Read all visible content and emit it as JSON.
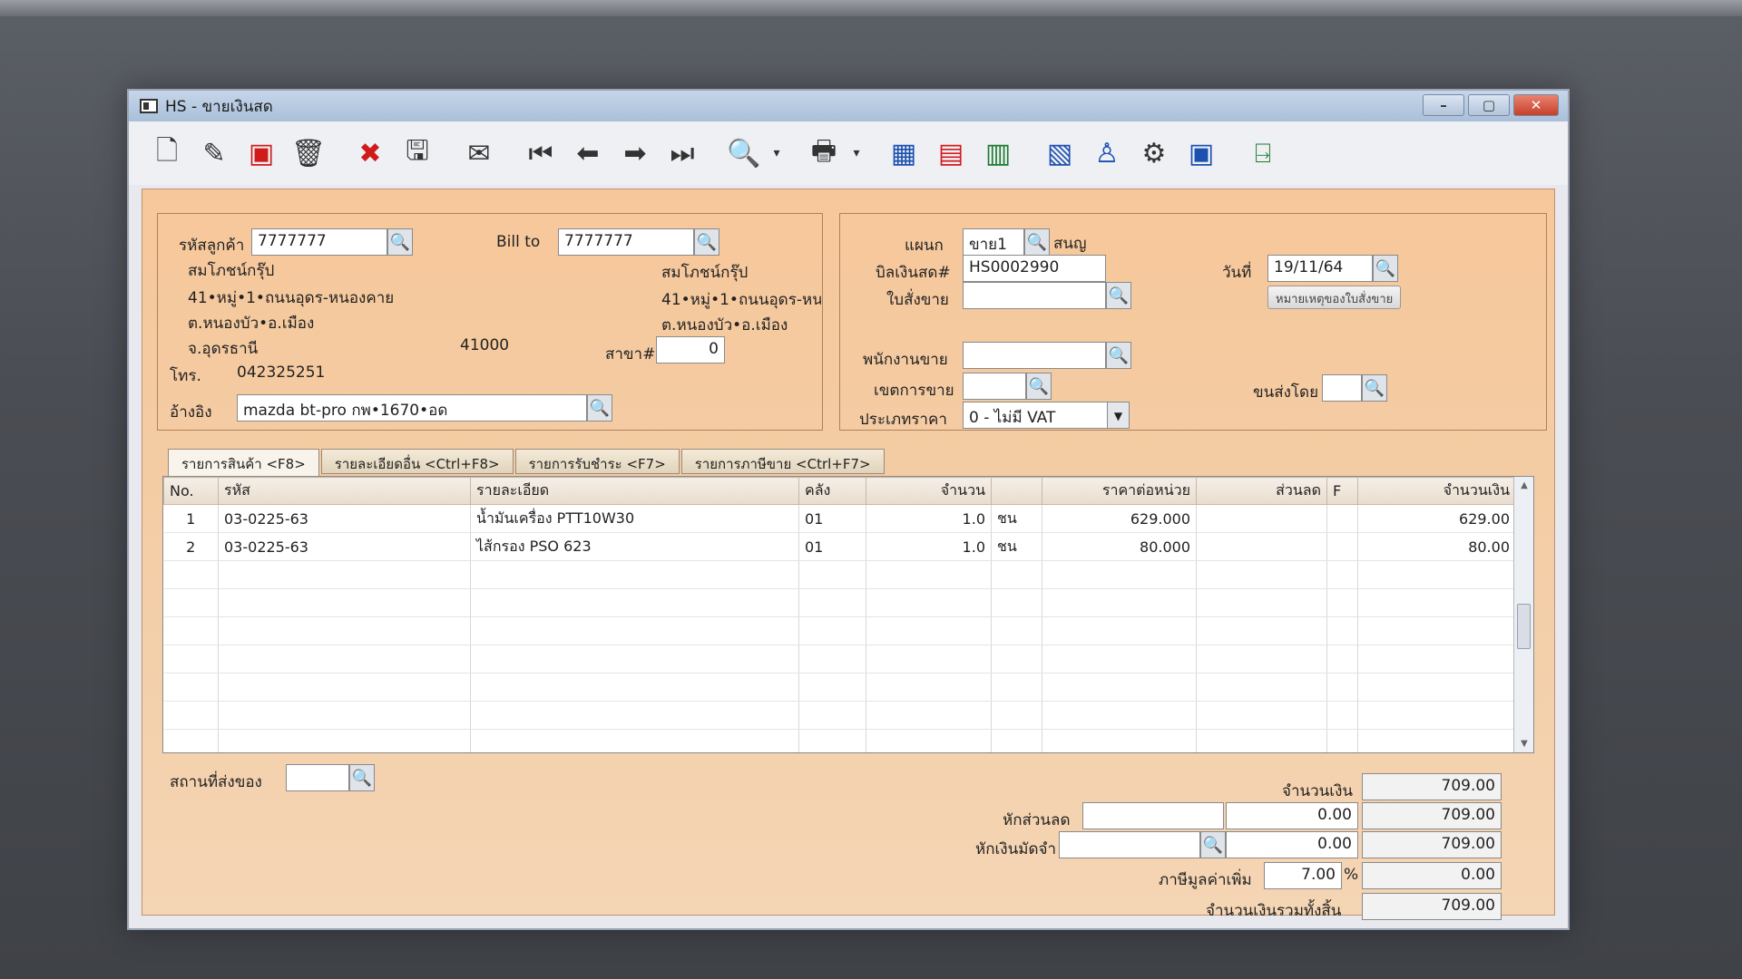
{
  "window": {
    "title": "HS - ขายเงินสด"
  },
  "customer": {
    "code_label": "รหัสลูกค้า",
    "code": "7777777",
    "name": "สมโภชน์กรุ๊ป",
    "address1": "41•หมู่•1•ถนนอุดร-หนองคาย",
    "address2": "ต.หนองบัว•อ.เมือง",
    "province": "จ.อุดรธานี",
    "zip": "41000",
    "phone_label": "โทร.",
    "phone": "042325251",
    "ref_label": "อ้างอิง",
    "ref": "mazda bt-pro กพ•1670•อด"
  },
  "billto": {
    "label": "Bill to",
    "code": "7777777",
    "name": "สมโภชน์กรุ๊ป",
    "address1": "41•หมู่•1•ถนนอุดร-หน",
    "address2": "ต.หนองบัว•อ.เมือง",
    "branch_label": "สาขา#",
    "branch": "0"
  },
  "doc": {
    "dept_label": "แผนก",
    "dept": "ขาย1",
    "dept_name": "สนญ",
    "bill_label": "บิลเงินสด#",
    "bill": "HS0002990",
    "date_label": "วันที่",
    "date": "19/11/64",
    "order_label": "ใบสั่งขาย",
    "order": "",
    "note_button": "หมายเหตุของใบสั่งขาย",
    "salesman_label": "พนักงานขาย",
    "salesman": "",
    "area_label": "เขตการขาย",
    "area": "",
    "ship_label": "ขนส่งโดย",
    "ship": "",
    "price_type_label": "ประเภทราคา",
    "price_type": "0 - ไม่มี VAT"
  },
  "tabs": [
    {
      "label": "รายการสินค้า <F8>"
    },
    {
      "label": "รายละเอียดอื่น <Ctrl+F8>"
    },
    {
      "label": "รายการรับชำระ <F7>"
    },
    {
      "label": "รายการภาษีขาย <Ctrl+F7>"
    }
  ],
  "grid": {
    "headers": [
      "No.",
      "รหัส",
      "รายละเอียด",
      "คลัง",
      "จำนวน",
      "",
      "ราคาต่อหน่วย",
      "ส่วนลด",
      "F",
      "จำนวนเงิน"
    ],
    "rows": [
      [
        "1",
        "03-0225-63",
        "น้ำมันเครื่อง PTT10W30",
        "01",
        "1.0",
        "ชน",
        "629.000",
        "",
        "",
        "629.00"
      ],
      [
        "2",
        "03-0225-63",
        "ไส้กรอง PSO 623",
        "01",
        "1.0",
        "ชน",
        "80.000",
        "",
        "",
        "80.00"
      ]
    ]
  },
  "footer": {
    "place_label": "สถานที่ส่งของ",
    "place": "",
    "amount_label": "จำนวนเงิน",
    "amount": "709.00",
    "discount_label": "หักส่วนลด",
    "discount_text": "",
    "discount": "0.00",
    "after_discount": "709.00",
    "deposit_label": "หักเงินมัดจำ",
    "deposit_text": "",
    "deposit": "0.00",
    "after_deposit": "709.00",
    "vat_label": "ภาษีมูลค่าเพิ่ม",
    "vat_rate": "7.00",
    "vat_pct": "%",
    "vat": "0.00",
    "total_label": "จำนวนเงินรวมทั้งสิ้น",
    "total": "709.00"
  }
}
